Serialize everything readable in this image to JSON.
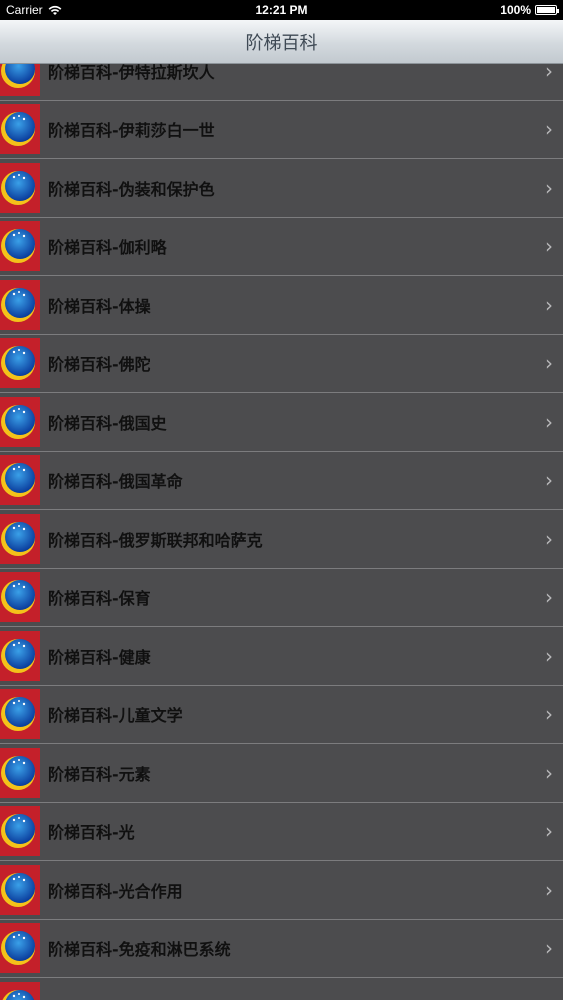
{
  "status_bar": {
    "carrier": "Carrier",
    "time": "12:21 PM",
    "battery": "100%",
    "battery_level": 1.0
  },
  "nav": {
    "title": "阶梯百科"
  },
  "icons": {
    "app": "app-logo-icon",
    "chevron": "chevron-right-icon",
    "wifi": "wifi-icon",
    "battery": "battery-icon"
  },
  "list": {
    "items": [
      {
        "label": "阶梯百科-伊特拉斯坎人"
      },
      {
        "label": "阶梯百科-伊莉莎白一世"
      },
      {
        "label": "阶梯百科-伪装和保护色"
      },
      {
        "label": "阶梯百科-伽利略"
      },
      {
        "label": "阶梯百科-体操"
      },
      {
        "label": "阶梯百科-佛陀"
      },
      {
        "label": "阶梯百科-俄国史"
      },
      {
        "label": "阶梯百科-俄国革命"
      },
      {
        "label": "阶梯百科-俄罗斯联邦和哈萨克"
      },
      {
        "label": "阶梯百科-保育"
      },
      {
        "label": "阶梯百科-健康"
      },
      {
        "label": "阶梯百科-儿童文学"
      },
      {
        "label": "阶梯百科-元素"
      },
      {
        "label": "阶梯百科-光"
      },
      {
        "label": "阶梯百科-光合作用"
      },
      {
        "label": "阶梯百科-免疫和淋巴系统"
      },
      {
        "label": ""
      }
    ],
    "chevron_glyph": "›"
  }
}
